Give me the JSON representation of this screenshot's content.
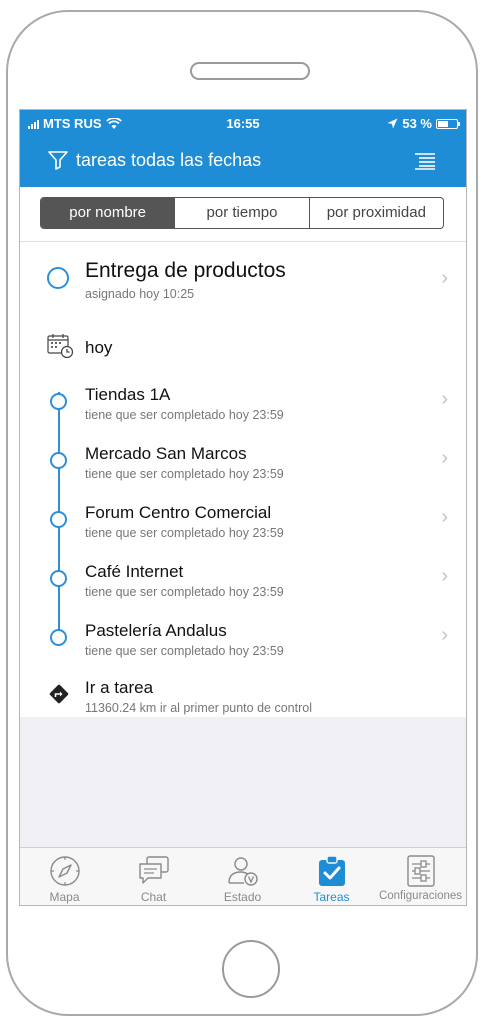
{
  "status_bar": {
    "carrier": "MTS RUS",
    "time": "16:55",
    "battery": "53 %"
  },
  "nav": {
    "title": "tareas todas las fechas"
  },
  "segments": [
    "por nombre",
    "por tiempo",
    "por proximidad"
  ],
  "task": {
    "title": "Entrega de productos",
    "subtitle": "asignado hoy 10:25"
  },
  "section": {
    "label": "hoy"
  },
  "checkpoints": [
    {
      "title": "Tiendas 1A",
      "subtitle": "tiene que ser completado hoy 23:59"
    },
    {
      "title": "Mercado San Marcos",
      "subtitle": "tiene que ser completado hoy 23:59"
    },
    {
      "title": "Forum Centro Comercial",
      "subtitle": "tiene que ser completado hoy 23:59"
    },
    {
      "title": "Café Internet",
      "subtitle": "tiene que ser completado hoy 23:59"
    },
    {
      "title": "Pastelería Andalus",
      "subtitle": "tiene que ser completado hoy 23:59"
    }
  ],
  "goto": {
    "title": "Ir a tarea",
    "subtitle": "11360.24 km ir al primer punto de control"
  },
  "tabs": [
    {
      "label": "Mapa",
      "icon": "compass-icon"
    },
    {
      "label": "Chat",
      "icon": "chat-icon"
    },
    {
      "label": "Estado",
      "icon": "user-status-icon"
    },
    {
      "label": "Tareas",
      "icon": "tasks-icon",
      "active": true
    },
    {
      "label": "Configuraciones",
      "icon": "settings-sliders-icon"
    }
  ],
  "colors": {
    "accent": "#1f8dd6",
    "list_background": "#efeff4"
  }
}
